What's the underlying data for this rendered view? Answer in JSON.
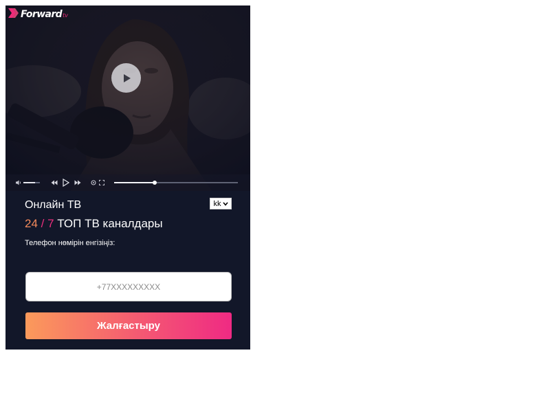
{
  "brand": {
    "name": "Forward",
    "suffix": "tv",
    "accent": "#ee2b79"
  },
  "video": {
    "state": "paused",
    "progress_fraction": 0.33,
    "volume_fraction": 0.7,
    "icons": [
      "volume-icon",
      "rewind-icon",
      "play-icon",
      "fast-forward-icon",
      "settings-icon",
      "fullscreen-icon",
      "play-large-icon"
    ]
  },
  "main": {
    "title": "Онлайн ТВ",
    "subtitle_num1": "24",
    "subtitle_slash": " / ",
    "subtitle_num2": "7",
    "subtitle_text": " ТОП ТВ каналдары",
    "phone_label": "Телефон нөмірін енгізіңіз:"
  },
  "language": {
    "selected": "kk"
  },
  "form": {
    "phone_placeholder": "+77XXXXXXXXX",
    "phone_value": "",
    "continue_label": "Жалғастыру"
  },
  "colors": {
    "panel_bg": "#121729",
    "gradient_start": "#fb9a5b",
    "gradient_end": "#ef2a83",
    "subtitle_orange": "#f48a5c",
    "subtitle_pink": "#ee2f7e"
  }
}
